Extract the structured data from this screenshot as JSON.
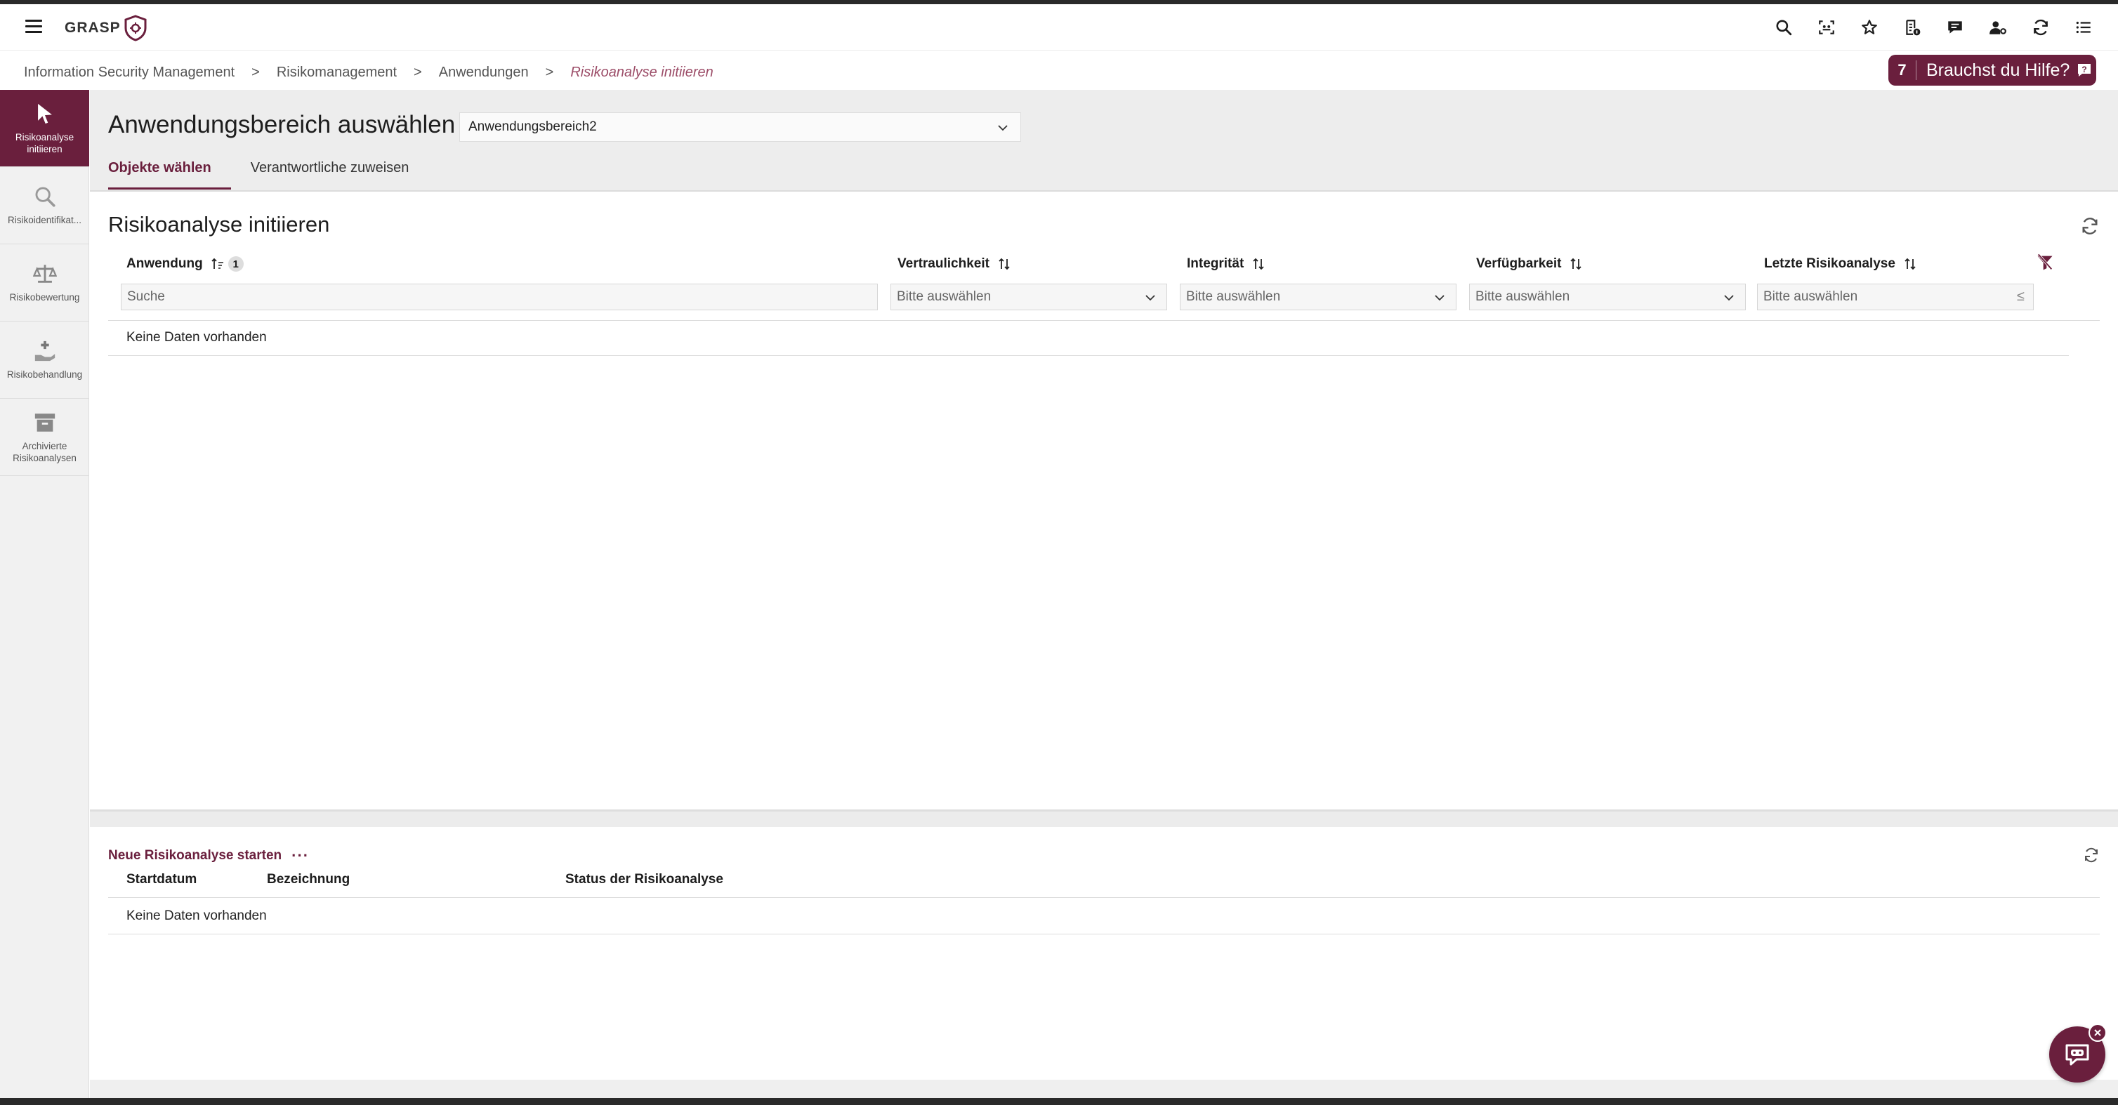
{
  "app": {
    "logo_text": "GRASP"
  },
  "colors": {
    "brand": "#6a1f3d",
    "brand_light": "#9c4d68",
    "panel_bg": "#ededed"
  },
  "topbar": {
    "icons": [
      "search-icon",
      "scan-icon",
      "star-icon",
      "document-info-icon",
      "message-icon",
      "user-settings-icon",
      "refresh-icon",
      "list-icon"
    ]
  },
  "breadcrumb": {
    "items": [
      "Information Security Management",
      "Risikomanagement",
      "Anwendungen"
    ],
    "separator": ">",
    "current": "Risikoanalyse initiieren"
  },
  "help": {
    "count": "7",
    "label": "Brauchst du Hilfe?"
  },
  "sidebar": {
    "items": [
      {
        "label": "Risikoanalyse initiieren",
        "icon": "cursor-icon",
        "active": true
      },
      {
        "label": "Risikoidentifikat...",
        "icon": "magnifier-icon",
        "active": false
      },
      {
        "label": "Risikobewertung",
        "icon": "scale-icon",
        "active": false
      },
      {
        "label": "Risikobehandlung",
        "icon": "hand-plus-icon",
        "active": false
      },
      {
        "label": "Archivierte Risikoanalysen",
        "icon": "archive-icon",
        "active": false
      }
    ]
  },
  "header": {
    "title": "Anwendungsbereich auswählen",
    "scope_value": "Anwendungsbereich2",
    "tabs": [
      {
        "label": "Objekte wählen",
        "active": true
      },
      {
        "label": "Verantwortliche zuweisen",
        "active": false
      }
    ]
  },
  "panel1": {
    "title": "Risikoanalyse initiieren",
    "columns": [
      {
        "label": "Anwendung",
        "sort_badge": "1"
      },
      {
        "label": "Vertraulichkeit"
      },
      {
        "label": "Integrität"
      },
      {
        "label": "Verfügbarkeit"
      },
      {
        "label": "Letzte Risikoanalyse"
      }
    ],
    "search_placeholder": "Suche",
    "filter_placeholder": "Bitte auswählen",
    "date_filter_symbol": "≤",
    "empty_text": "Keine Daten vorhanden"
  },
  "panel2": {
    "title": "Neue Risikoanalyse starten",
    "dots": "···",
    "columns": [
      "Startdatum",
      "Bezeichnung",
      "Status der Risikoanalyse"
    ],
    "empty_text": "Keine Daten vorhanden"
  }
}
